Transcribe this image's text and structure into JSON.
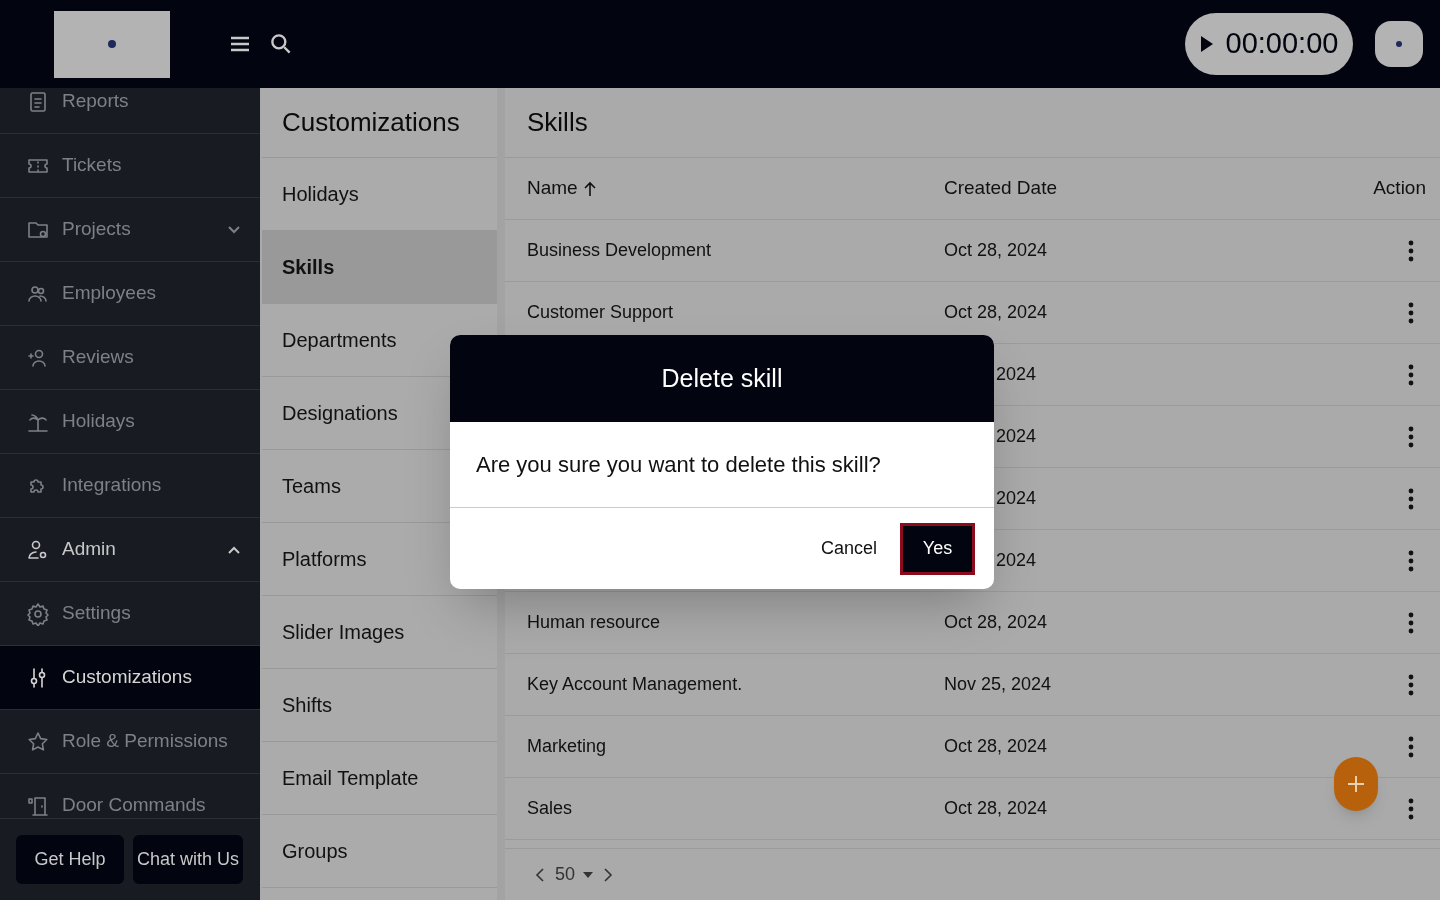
{
  "top_bar": {
    "timer": "00:00:00"
  },
  "sidebar": {
    "items": [
      {
        "label": "Reports",
        "kind": "link",
        "selected": false
      },
      {
        "label": "Tickets",
        "kind": "link",
        "selected": false
      },
      {
        "label": "Projects",
        "kind": "group",
        "expanded": false,
        "selected": false
      },
      {
        "label": "Employees",
        "kind": "link",
        "selected": false
      },
      {
        "label": "Reviews",
        "kind": "link",
        "selected": false
      },
      {
        "label": "Holidays",
        "kind": "link",
        "selected": false
      },
      {
        "label": "Integrations",
        "kind": "link",
        "selected": false
      },
      {
        "label": "Admin",
        "kind": "group",
        "expanded": true,
        "selected": false
      },
      {
        "label": "Settings",
        "kind": "link",
        "selected": false
      },
      {
        "label": "Customizations",
        "kind": "link",
        "selected": true
      },
      {
        "label": "Role & Permissions",
        "kind": "link",
        "selected": false
      },
      {
        "label": "Door Commands",
        "kind": "link",
        "selected": false
      }
    ],
    "buttons": [
      "Get Help",
      "Chat with Us"
    ]
  },
  "customizations": {
    "title": "Customizations",
    "items": [
      {
        "label": "Holidays",
        "selected": false
      },
      {
        "label": "Skills",
        "selected": true
      },
      {
        "label": "Departments",
        "selected": false
      },
      {
        "label": "Designations",
        "selected": false
      },
      {
        "label": "Teams",
        "selected": false
      },
      {
        "label": "Platforms",
        "selected": false
      },
      {
        "label": "Slider Images",
        "selected": false
      },
      {
        "label": "Shifts",
        "selected": false
      },
      {
        "label": "Email Template",
        "selected": false
      },
      {
        "label": "Groups",
        "selected": false
      }
    ]
  },
  "table": {
    "title": "Skills",
    "columns": [
      "Name",
      "Created Date",
      "Action"
    ],
    "rows": [
      {
        "name": "Business Development",
        "created_date": "Oct 28, 2024"
      },
      {
        "name": "Customer Support",
        "created_date": "Oct 28, 2024"
      },
      {
        "created_date": "2024"
      },
      {
        "created_date": "2024"
      },
      {
        "created_date": "2024"
      },
      {
        "created_date": "2024"
      },
      {
        "name": "Human resource",
        "created_date": "Oct 28, 2024"
      },
      {
        "name": "Key Account Management.",
        "created_date": "Nov 25, 2024"
      },
      {
        "name": "Marketing",
        "created_date": "Oct 28, 2024"
      },
      {
        "name": "Sales",
        "created_date": "Oct 28, 2024"
      }
    ],
    "pagination": {
      "page_size": "50"
    }
  },
  "dialog": {
    "title": "Delete skill",
    "message": "Are you sure you want to delete this skill?",
    "buttons": [
      {
        "label": "Cancel",
        "kind": "secondary"
      },
      {
        "label": "Yes",
        "kind": "primary"
      }
    ]
  }
}
